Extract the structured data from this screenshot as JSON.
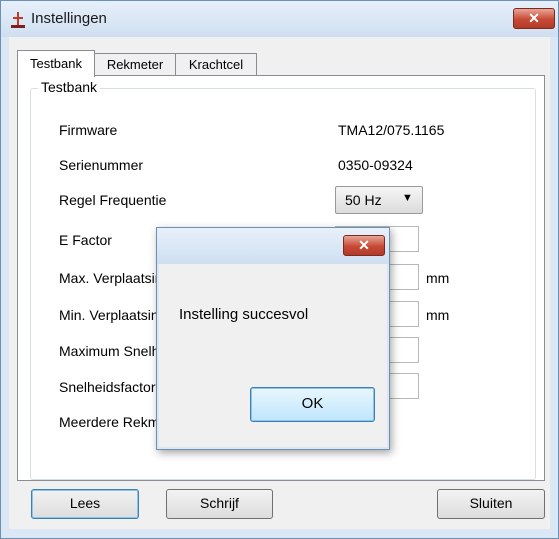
{
  "window": {
    "title": "Instellingen",
    "close_glyph": "✕",
    "icon": "app-icon",
    "close_icon": "close-icon"
  },
  "tabs": [
    {
      "label": "Testbank",
      "active": true
    },
    {
      "label": "Rekmeter",
      "active": false
    },
    {
      "label": "Krachtcel",
      "active": false
    }
  ],
  "group": {
    "title": "Testbank",
    "fields": {
      "firmware": {
        "label": "Firmware",
        "value": "TMA12/075.1165"
      },
      "serial": {
        "label": "Serienummer",
        "value": "0350-09324"
      },
      "frequency": {
        "label": "Regel Frequentie",
        "value": "50 Hz",
        "arrow": "▼"
      },
      "e_factor": {
        "label": "E Factor"
      },
      "max_disp": {
        "label": "Max. Verplaatsing",
        "unit": "mm"
      },
      "min_disp": {
        "label": "Min. Verplaatsing",
        "unit": "mm"
      },
      "max_speed": {
        "label": "Maximum Snelheid"
      },
      "speed_factor": {
        "label": "Snelheidsfactor"
      },
      "multiple": {
        "label": "Meerdere Rekmeters"
      }
    }
  },
  "buttons": {
    "read": "Lees",
    "write": "Schrijf",
    "close": "Sluiten"
  },
  "dialog": {
    "message": "Instelling succesvol",
    "ok": "OK",
    "close_glyph": "✕"
  },
  "colors": {
    "close_button": "#c74a36",
    "frame": "#dbe7f4",
    "default_button_border": "#3c7fb1"
  }
}
